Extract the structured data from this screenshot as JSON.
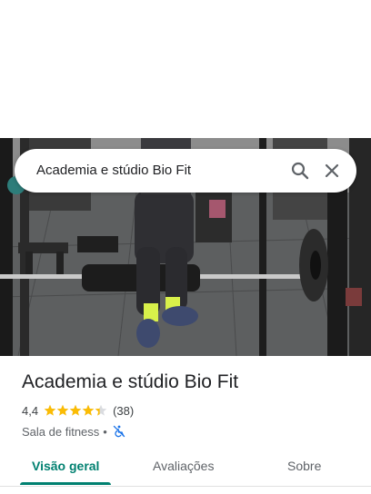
{
  "search": {
    "query": "Academia e stúdio Bio Fit"
  },
  "place": {
    "title": "Academia e stúdio Bio Fit",
    "rating": "4,4",
    "stars": 4.4,
    "review_count": "(38)",
    "category": "Sala de fitness",
    "separator": "•"
  },
  "tabs": [
    {
      "label": "Visão geral",
      "selected": true
    },
    {
      "label": "Avaliações",
      "selected": false
    },
    {
      "label": "Sobre",
      "selected": false
    }
  ],
  "icons": {
    "search": "search-icon",
    "close": "close-icon",
    "accessibility": "wheelchair-not-accessible-icon",
    "stars": "star-icon"
  },
  "colors": {
    "accent": "#008070",
    "star": "#fbbc04",
    "access_icon": "#1a73e8"
  }
}
